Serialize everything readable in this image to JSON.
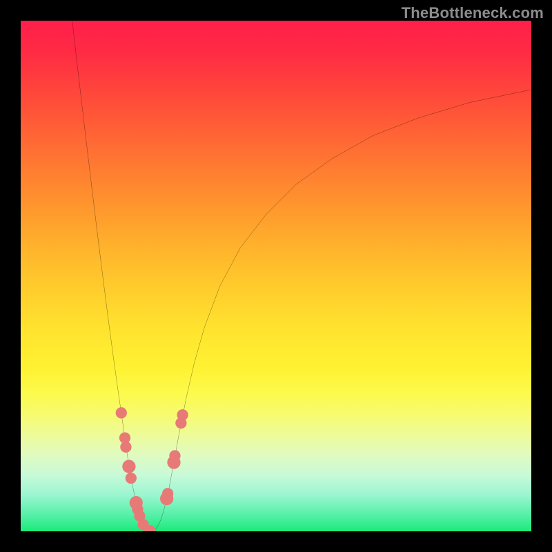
{
  "watermark": "TheBottleneck.com",
  "colors": {
    "background": "#000000",
    "curve": "#000000",
    "marker": "#e77a76",
    "watermark": "#8c8c8c"
  },
  "chart_data": {
    "type": "line",
    "title": "",
    "xlabel": "",
    "ylabel": "",
    "xlim": [
      0,
      100
    ],
    "ylim": [
      0,
      100
    ],
    "curves": {
      "left": [
        {
          "x": 10.1,
          "y": 100.0
        },
        {
          "x": 11.0,
          "y": 92.0
        },
        {
          "x": 12.0,
          "y": 83.5
        },
        {
          "x": 13.0,
          "y": 75.0
        },
        {
          "x": 14.0,
          "y": 66.7
        },
        {
          "x": 15.0,
          "y": 58.5
        },
        {
          "x": 16.0,
          "y": 50.5
        },
        {
          "x": 17.0,
          "y": 42.7
        },
        {
          "x": 18.0,
          "y": 35.2
        },
        {
          "x": 19.0,
          "y": 28.0
        },
        {
          "x": 19.8,
          "y": 22.5
        },
        {
          "x": 20.5,
          "y": 17.5
        },
        {
          "x": 21.0,
          "y": 14.2
        },
        {
          "x": 21.5,
          "y": 11.2
        },
        {
          "x": 22.0,
          "y": 8.5
        },
        {
          "x": 22.5,
          "y": 6.1
        },
        {
          "x": 23.0,
          "y": 4.2
        },
        {
          "x": 23.5,
          "y": 2.6
        },
        {
          "x": 24.0,
          "y": 1.4
        },
        {
          "x": 24.5,
          "y": 0.6
        },
        {
          "x": 25.0,
          "y": 0.15
        },
        {
          "x": 25.5,
          "y": 0.0
        }
      ],
      "right": [
        {
          "x": 25.5,
          "y": 0.0
        },
        {
          "x": 26.0,
          "y": 0.1
        },
        {
          "x": 26.5,
          "y": 0.5
        },
        {
          "x": 27.0,
          "y": 1.3
        },
        {
          "x": 27.5,
          "y": 2.4
        },
        {
          "x": 28.0,
          "y": 4.0
        },
        {
          "x": 29.0,
          "y": 8.2
        },
        {
          "x": 30.0,
          "y": 13.5
        },
        {
          "x": 31.0,
          "y": 19.0
        },
        {
          "x": 32.5,
          "y": 26.5
        },
        {
          "x": 34.0,
          "y": 33.0
        },
        {
          "x": 36.0,
          "y": 40.0
        },
        {
          "x": 39.0,
          "y": 48.0
        },
        {
          "x": 43.0,
          "y": 55.5
        },
        {
          "x": 48.0,
          "y": 62.0
        },
        {
          "x": 54.0,
          "y": 68.0
        },
        {
          "x": 61.0,
          "y": 73.0
        },
        {
          "x": 69.0,
          "y": 77.5
        },
        {
          "x": 78.0,
          "y": 81.0
        },
        {
          "x": 88.0,
          "y": 84.0
        },
        {
          "x": 100.0,
          "y": 86.5
        }
      ]
    },
    "markers": [
      {
        "x": 19.7,
        "y": 23.2,
        "r": 1.1
      },
      {
        "x": 20.4,
        "y": 18.3,
        "r": 1.1
      },
      {
        "x": 20.6,
        "y": 16.5,
        "r": 1.1
      },
      {
        "x": 21.2,
        "y": 12.7,
        "r": 1.3
      },
      {
        "x": 21.6,
        "y": 10.4,
        "r": 1.1
      },
      {
        "x": 22.6,
        "y": 5.6,
        "r": 1.3
      },
      {
        "x": 22.9,
        "y": 4.3,
        "r": 1.1
      },
      {
        "x": 23.3,
        "y": 3.0,
        "r": 1.1
      },
      {
        "x": 24.0,
        "y": 1.3,
        "r": 1.1
      },
      {
        "x": 25.3,
        "y": 0.1,
        "r": 1.1
      },
      {
        "x": 28.6,
        "y": 6.4,
        "r": 1.3
      },
      {
        "x": 28.8,
        "y": 7.4,
        "r": 1.1
      },
      {
        "x": 30.0,
        "y": 13.5,
        "r": 1.3
      },
      {
        "x": 30.2,
        "y": 14.8,
        "r": 1.1
      },
      {
        "x": 31.4,
        "y": 21.2,
        "r": 1.1
      },
      {
        "x": 31.7,
        "y": 22.8,
        "r": 1.1
      }
    ]
  }
}
